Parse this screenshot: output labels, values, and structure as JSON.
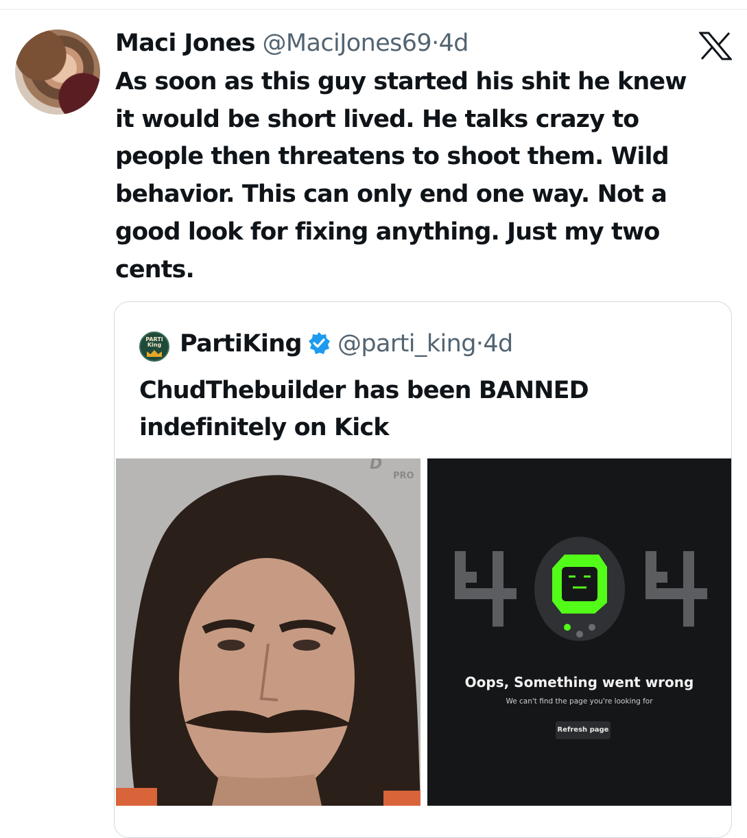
{
  "tweet": {
    "author_name": "Maci Jones",
    "author_handle": "@MaciJones69",
    "separator": "·",
    "time": "4d",
    "lines": [
      "As soon as this guy started his shit he knew",
      "it would be short lived. He talks crazy to",
      "people then threatens to shoot them. Wild",
      "behavior. This can only end one way. Not a",
      "good look for fixing anything. Just my two",
      "cents."
    ]
  },
  "quoted": {
    "author_name": "PartiKing",
    "author_handle": "@parti_king",
    "separator": "·",
    "time": "4d",
    "avatar_text": "PARTI King",
    "lines": [
      "ChudThebuilder has been BANNED",
      "indefinitely on Kick"
    ],
    "photo_watermark": "PRO",
    "error_page": {
      "code": "404",
      "title": "Oops, Something went wrong",
      "subtitle": "We can't find the page you're looking for",
      "button_label": "Refresh page"
    }
  },
  "icons": {
    "platform_logo": "x-logo-icon",
    "verified": "verified-badge-icon"
  },
  "colors": {
    "text": "#0f1419",
    "secondary": "#536471",
    "verified_blue": "#1d9bf0",
    "kick_green": "#53fc18"
  }
}
